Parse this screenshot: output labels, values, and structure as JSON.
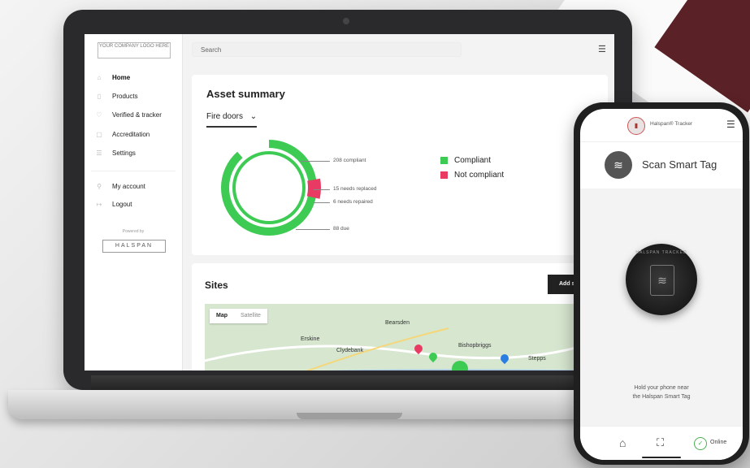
{
  "colors": {
    "compliant": "#3ecb54",
    "not_compliant": "#e83a62",
    "dark": "#222222"
  },
  "laptop": {
    "logo_text": "YOUR COMPANY LOGO HERE",
    "sidebar": {
      "items": [
        {
          "label": "Home",
          "icon": "home-icon",
          "active": true
        },
        {
          "label": "Products",
          "icon": "document-icon"
        },
        {
          "label": "Verified & tracker",
          "icon": "pin-icon"
        },
        {
          "label": "Accreditation",
          "icon": "badge-icon"
        },
        {
          "label": "Settings",
          "icon": "settings-icon"
        }
      ],
      "account_items": [
        {
          "label": "My account",
          "icon": "user-icon"
        },
        {
          "label": "Logout",
          "icon": "logout-icon"
        }
      ],
      "powered_by": "Powered by",
      "brand": "HALSPAN"
    },
    "search": {
      "placeholder": "Search"
    },
    "asset_summary": {
      "title": "Asset summary",
      "filter": "Fire doors",
      "annotations": [
        "208 compliant",
        "15 needs replaced",
        "6 needs repaired",
        "88 due"
      ],
      "legend": [
        {
          "label": "Compliant",
          "color": "#3ecb54"
        },
        {
          "label": "Not compliant",
          "color": "#e83a62"
        }
      ],
      "counts": {
        "compliant": 208,
        "needs_replaced": 15,
        "needs_repaired": 6,
        "due": 88
      }
    },
    "sites": {
      "title": "Sites",
      "add_button": "Add s",
      "map_tabs": [
        "Map",
        "Satellite"
      ],
      "map_labels": [
        "Bearsden",
        "Erskine",
        "Clydebank",
        "Bishopbriggs",
        "Stepps"
      ]
    }
  },
  "phone": {
    "app_name": "Halspan® Tracker",
    "scan_label": "Scan Smart Tag",
    "tag_text": "HALSPAN TRACKED",
    "instruction_line1": "Hold your phone near",
    "instruction_line2": "the Halspan Smart Tag",
    "status": "Online"
  }
}
